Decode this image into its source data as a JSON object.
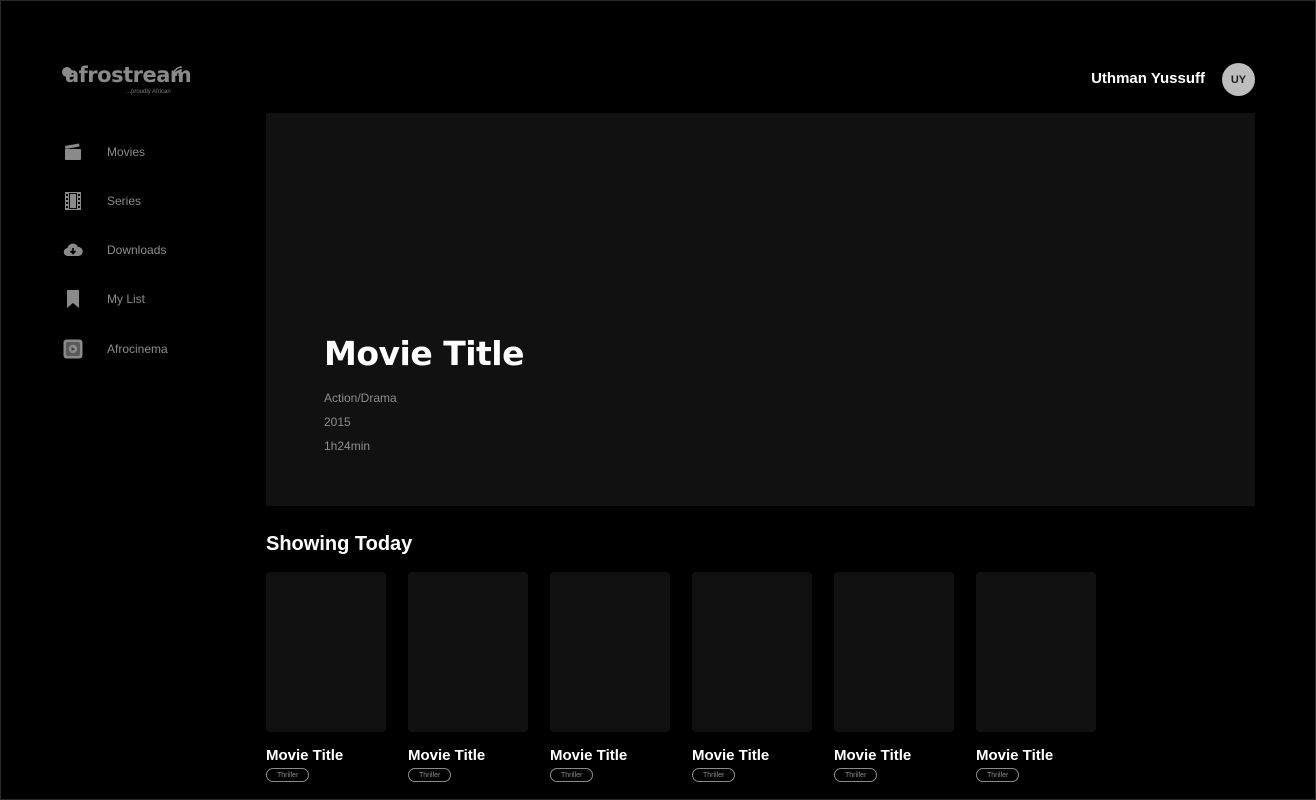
{
  "brand": {
    "name": "afrostream",
    "tagline": "...proudly African"
  },
  "colors": {
    "background": "#000000",
    "panel": "#111111",
    "muted_text": "#8c8c8c",
    "text": "#ffffff",
    "avatar_bg": "#bdbdbd"
  },
  "sidebar": {
    "items": [
      {
        "label": "Movies",
        "icon": "clapperboard-icon"
      },
      {
        "label": "Series",
        "icon": "film-strip-icon"
      },
      {
        "label": "Downloads",
        "icon": "cloud-download-icon"
      },
      {
        "label": "My List",
        "icon": "bookmark-icon"
      },
      {
        "label": "Afrocinema",
        "icon": "play-screen-icon"
      }
    ]
  },
  "header": {
    "user_name": "Uthman Yussuff",
    "avatar_initials": "UY"
  },
  "hero": {
    "title": "Movie Title",
    "genre": "Action/Drama",
    "year": "2015",
    "duration": "1h24min"
  },
  "showing_today": {
    "title": "Showing Today",
    "cards": [
      {
        "title": "Movie Title",
        "tag": "Thriller"
      },
      {
        "title": "Movie Title",
        "tag": "Thriller"
      },
      {
        "title": "Movie Title",
        "tag": "Thriller"
      },
      {
        "title": "Movie Title",
        "tag": "Thriller"
      },
      {
        "title": "Movie Title",
        "tag": "Thriller"
      },
      {
        "title": "Movie Title",
        "tag": "Thriller"
      }
    ]
  }
}
